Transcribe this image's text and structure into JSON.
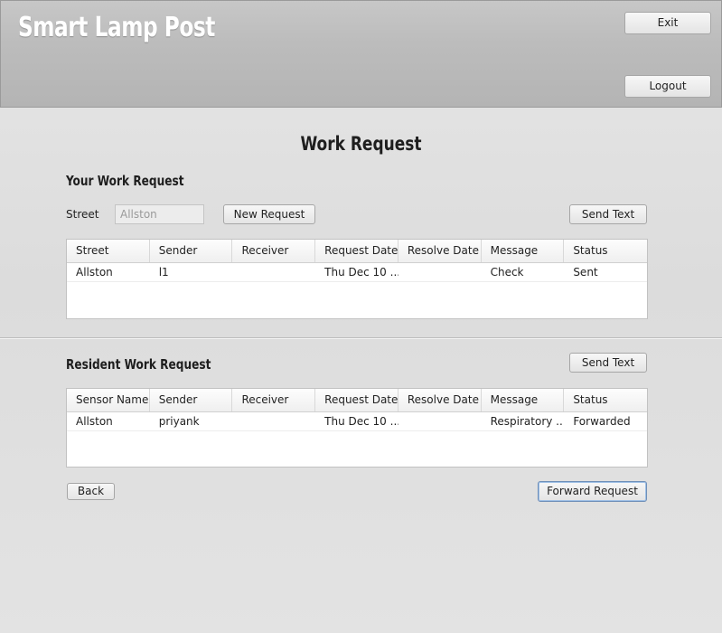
{
  "header": {
    "app_title": "Smart Lamp Post",
    "exit_label": "Exit",
    "logout_label": "Logout"
  },
  "page": {
    "title": "Work Request"
  },
  "your_requests": {
    "title": "Your Work Request",
    "street_label": "Street",
    "street_value": "Allston",
    "new_request_label": "New Request",
    "send_text_label": "Send Text",
    "columns": [
      "Street",
      "Sender",
      "Receiver",
      "Request Date",
      "Resolve Date",
      "Message",
      "Status"
    ],
    "rows": [
      [
        "Allston",
        "l1",
        "",
        "Thu Dec 10 ...",
        "",
        "Check",
        "Sent"
      ]
    ]
  },
  "resident_requests": {
    "title": "Resident Work Request",
    "send_text_label": "Send Text",
    "columns": [
      "Sensor Name",
      "Sender",
      "Receiver",
      "Request Date",
      "Resolve Date",
      "Message",
      "Status"
    ],
    "rows": [
      [
        "Allston",
        "priyank",
        "",
        "Thu Dec 10 ...",
        "",
        "Respiratory ...",
        "Forwarded"
      ]
    ]
  },
  "footer": {
    "back_label": "Back",
    "forward_label": "Forward Request"
  }
}
